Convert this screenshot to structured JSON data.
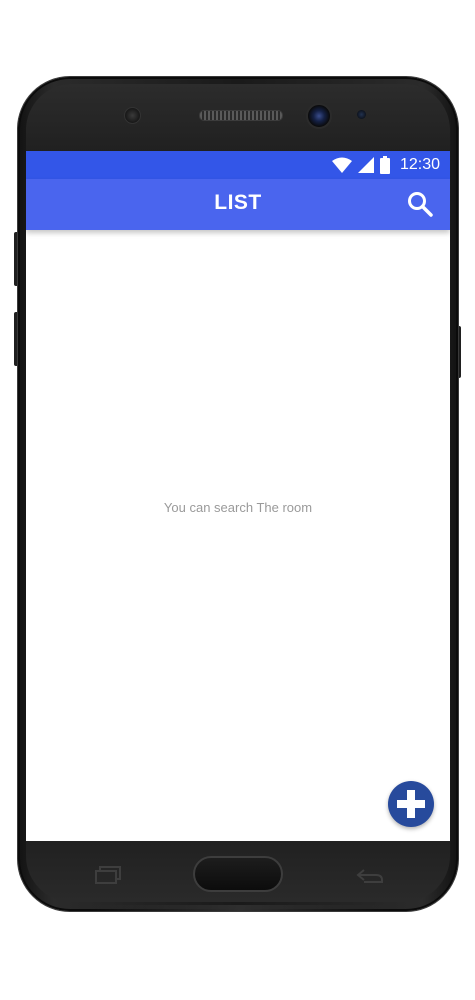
{
  "status_bar": {
    "time": "12:30",
    "icons": [
      "wifi-icon",
      "cellular-signal-icon",
      "battery-icon"
    ],
    "color": "#3356e8"
  },
  "app_bar": {
    "title": "LIST",
    "action_icon": "search-icon",
    "color": "#4a65ee"
  },
  "main": {
    "empty_message": "You can search The room"
  },
  "fab": {
    "icon": "plus-icon",
    "color": "#274a9c"
  },
  "device": {
    "nav_icons": [
      "recent-apps-icon",
      "home-button",
      "back-icon"
    ]
  }
}
